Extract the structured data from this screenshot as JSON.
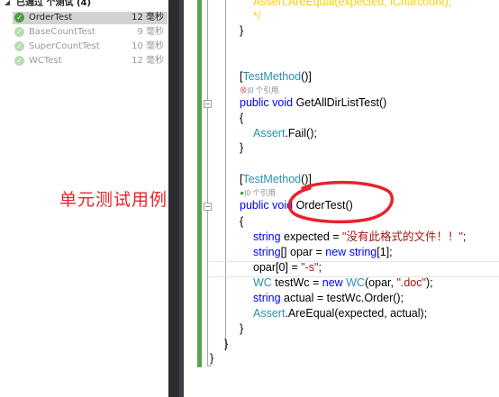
{
  "test_explorer": {
    "group_label": "已通过 个测试 (4)",
    "tests": [
      {
        "name": "OrderTest",
        "duration": "12 毫秒",
        "selected": true
      },
      {
        "name": "BaseCountTest",
        "duration": "9 毫秒",
        "selected": false
      },
      {
        "name": "SuperCountTest",
        "duration": "10 毫秒",
        "selected": false
      },
      {
        "name": "WCTest",
        "duration": "12 毫秒",
        "selected": false
      }
    ]
  },
  "annotation": "单元测试用例",
  "code": {
    "top_partial": {
      "call": "Assert.AreEqual(expected, iCharcount);",
      "close_comment": "*/",
      "brace": "}"
    },
    "method1": {
      "attribute": "TestMethod",
      "codelens": "|0 个引用",
      "kw_public": "public",
      "kw_void": "void",
      "name": "GetAllDirListTest()",
      "open": "{",
      "assert_type": "Assert",
      "assert_call": ".Fail();",
      "close": "}"
    },
    "method2": {
      "attribute": "TestMethod",
      "codelens": "|0 个引用",
      "kw_public": "public",
      "kw_void": "void",
      "name": "OrderTest()",
      "open": "{",
      "l1_type": "string",
      "l1_rest": " expected = ",
      "l1_str": "\"没有此格式的文件！！\"",
      "l1_end": ";",
      "l2_type": "string",
      "l2_mid": "[] opar = ",
      "l2_new": "new",
      "l2_type2": "string",
      "l2_end": "[1];",
      "l3_start": "opar[0] = ",
      "l3_str": "\"-s\"",
      "l3_end": ";",
      "l4_type": "WC",
      "l4_mid": " testWc = ",
      "l4_new": "new",
      "l4_type2": "WC",
      "l4_args": "(opar, ",
      "l4_str": "\".doc\"",
      "l4_end": ");",
      "l5_type": "string",
      "l5_rest": " actual = testWc.Order();",
      "l6_type": "Assert",
      "l6_rest": ".AreEqual(expected, actual);",
      "close": "}"
    },
    "class_close": "}",
    "namespace_close": "}"
  },
  "colors": {
    "keyword": "#0000ff",
    "type": "#2b91af",
    "string": "#a31515",
    "annotation_red": "#e8232d",
    "pass_green": "#4aa03c"
  }
}
